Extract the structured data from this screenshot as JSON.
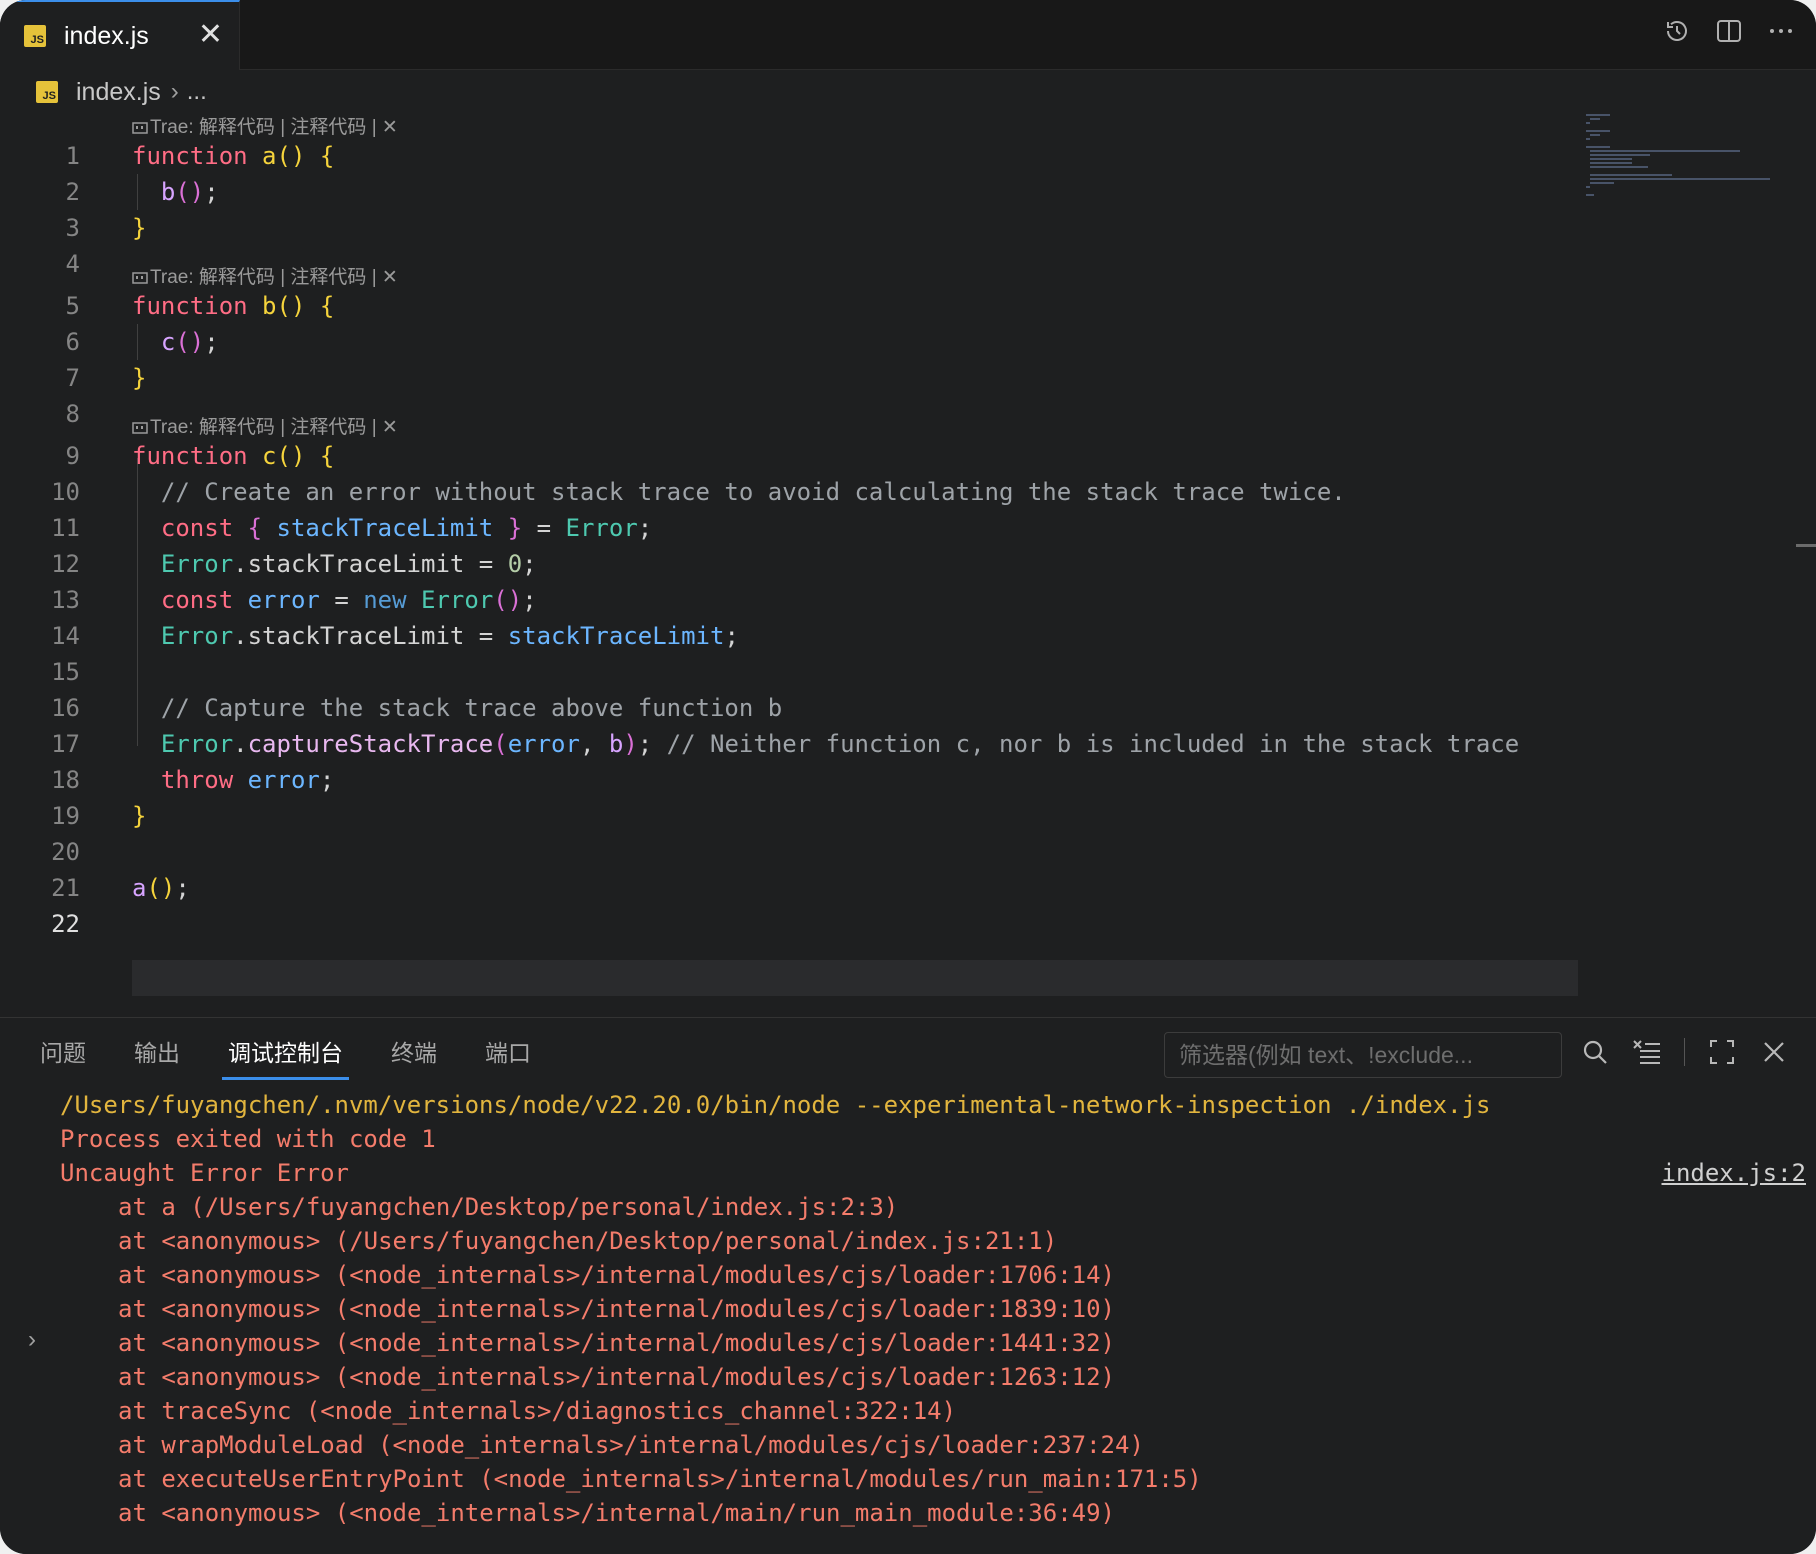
{
  "tab": {
    "label": "index.js",
    "icon_text": "JS",
    "close": "✕"
  },
  "breadcrumb": {
    "file": "index.js",
    "sep": "›",
    "more": "..."
  },
  "codelens": {
    "text": "Trae: 解释代码 | 注释代码 | ✕"
  },
  "editor_lines": [
    {
      "n": "1"
    },
    {
      "n": "2"
    },
    {
      "n": "3"
    },
    {
      "n": "4"
    },
    {
      "n": "5"
    },
    {
      "n": "6"
    },
    {
      "n": "7"
    },
    {
      "n": "8"
    },
    {
      "n": "9"
    },
    {
      "n": "10"
    },
    {
      "n": "11"
    },
    {
      "n": "12"
    },
    {
      "n": "13"
    },
    {
      "n": "14"
    },
    {
      "n": "15"
    },
    {
      "n": "16"
    },
    {
      "n": "17"
    },
    {
      "n": "18"
    },
    {
      "n": "19"
    },
    {
      "n": "20"
    },
    {
      "n": "21"
    },
    {
      "n": "22"
    }
  ],
  "code": {
    "l1": {
      "kw": "function",
      "name": "a",
      "p": "()",
      "b": "{"
    },
    "l2": {
      "call": "b",
      "p": "()",
      "end": ";"
    },
    "l3": {
      "b": "}"
    },
    "l5": {
      "kw": "function",
      "name": "b",
      "p": "()",
      "b": "{"
    },
    "l6": {
      "call": "c",
      "p": "()",
      "end": ";"
    },
    "l7": {
      "b": "}"
    },
    "l9": {
      "kw": "function",
      "name": "c",
      "p": "()",
      "b": "{"
    },
    "l10": {
      "comment": "// Create an error without stack trace to avoid calculating the stack trace twice."
    },
    "l11": {
      "kw": "const",
      "ob": "{",
      "var": "stackTraceLimit",
      "cb": "}",
      "eq": "=",
      "cls": "Error",
      "end": ";"
    },
    "l12": {
      "cls": "Error",
      "prop": ".stackTraceLimit",
      "eq": "=",
      "num": "0",
      "end": ";"
    },
    "l13": {
      "kw": "const",
      "var": "error",
      "eq": "=",
      "new": "new",
      "cls": "Error",
      "p": "()",
      "end": ";"
    },
    "l14": {
      "cls": "Error",
      "prop": ".stackTraceLimit",
      "eq": "=",
      "var": "stackTraceLimit",
      "end": ";"
    },
    "l16": {
      "comment": "// Capture the stack trace above function b"
    },
    "l17": {
      "cls": "Error",
      "dot": ".",
      "method": "captureStackTrace",
      "po": "(",
      "arg1": "error",
      "comma": ",",
      "arg2": "b",
      "pc": ")",
      "end": ";",
      "comment": "// Neither function c, nor b is included in the stack trace"
    },
    "l18": {
      "kw": "throw",
      "var": "error",
      "end": ";"
    },
    "l19": {
      "b": "}"
    },
    "l21": {
      "call": "a",
      "p": "()",
      "end": ";"
    }
  },
  "panel": {
    "tabs": [
      "问题",
      "输出",
      "调试控制台",
      "终端",
      "端口"
    ],
    "active_tab": "调试控制台",
    "filter_placeholder": "筛选器(例如 text、!exclude..."
  },
  "console": {
    "command": "/Users/fuyangchen/.nvm/versions/node/v22.20.0/bin/node --experimental-network-inspection ./index.js",
    "exit": "Process exited with code 1",
    "error": "Uncaught Error Error",
    "source_link": "index.js:2",
    "expander": "›",
    "stack": [
      "at a (/Users/fuyangchen/Desktop/personal/index.js:2:3)",
      "at <anonymous> (/Users/fuyangchen/Desktop/personal/index.js:21:1)",
      "at <anonymous> (<node_internals>/internal/modules/cjs/loader:1706:14)",
      "at <anonymous> (<node_internals>/internal/modules/cjs/loader:1839:10)",
      "at <anonymous> (<node_internals>/internal/modules/cjs/loader:1441:32)",
      "at <anonymous> (<node_internals>/internal/modules/cjs/loader:1263:12)",
      "at traceSync (<node_internals>/diagnostics_channel:322:14)",
      "at wrapModuleLoad (<node_internals>/internal/modules/cjs/loader:237:24)",
      "at executeUserEntryPoint (<node_internals>/internal/modules/run_main:171:5)",
      "at <anonymous> (<node_internals>/internal/main/run_main_module:36:49)"
    ]
  },
  "colors": {
    "accent": "#3b8eea",
    "background": "#1e1f20",
    "console_yellow": "#e2b53e",
    "console_red": "#f47c6b"
  }
}
